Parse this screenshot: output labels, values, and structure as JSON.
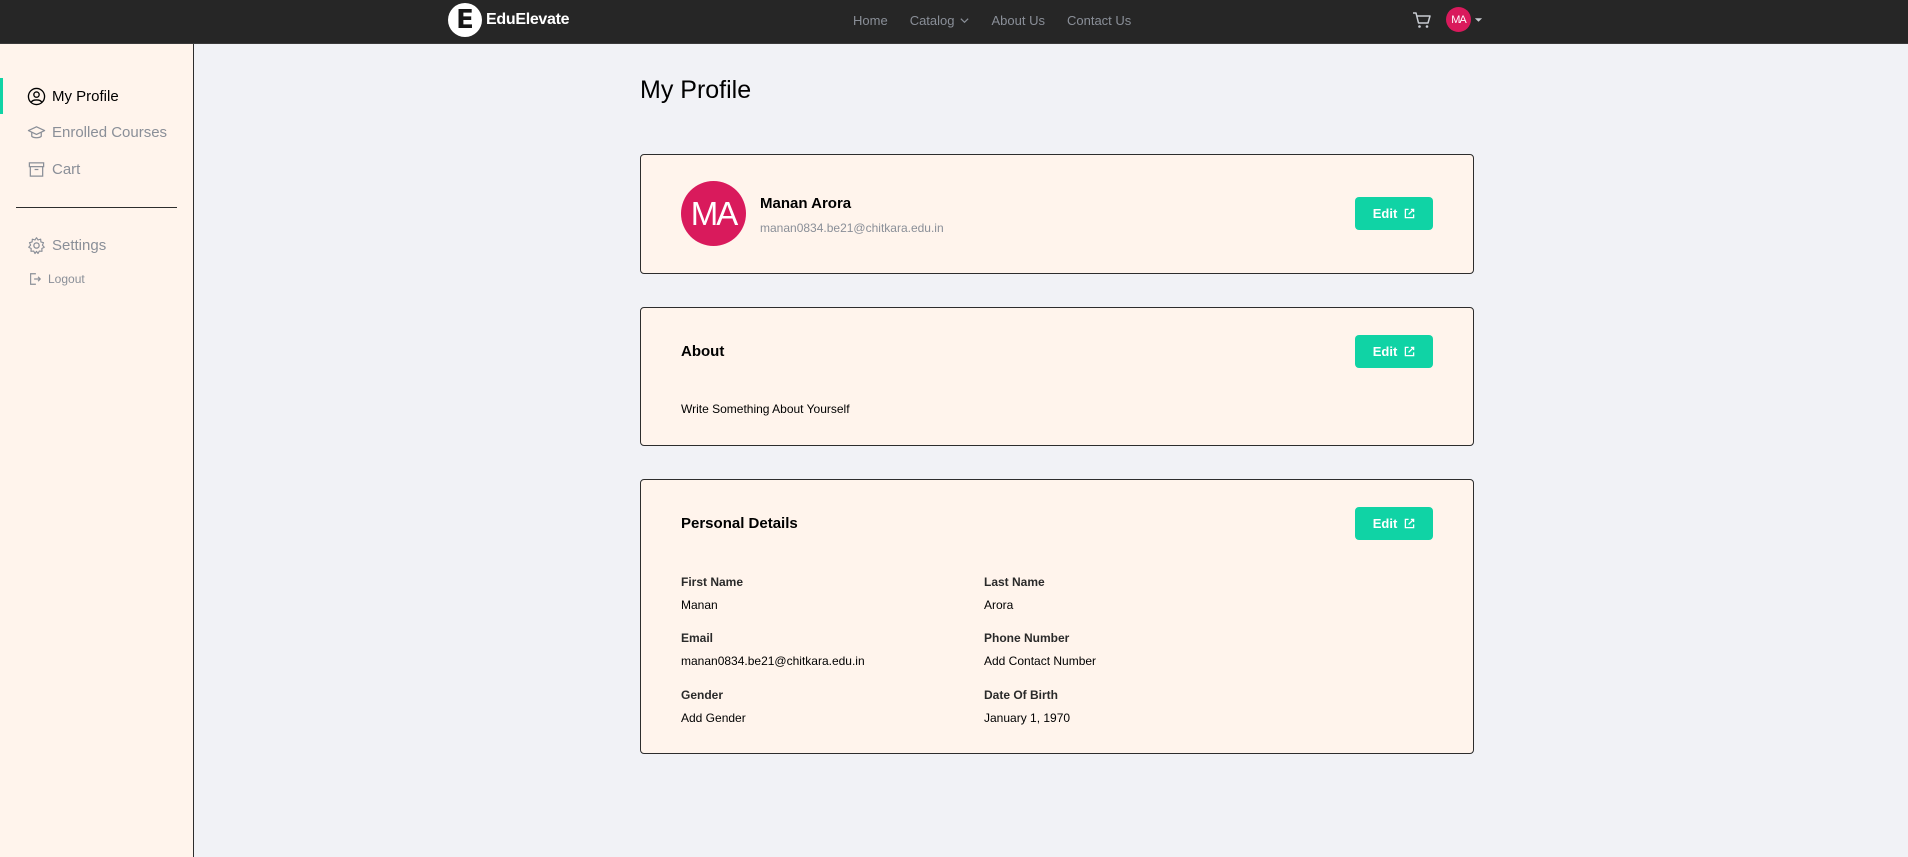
{
  "brand": {
    "logo_letter": "E",
    "name": "EduElevate"
  },
  "nav": {
    "home": "Home",
    "catalog": "Catalog",
    "about": "About Us",
    "contact": "Contact Us"
  },
  "user": {
    "initials": "MA",
    "name": "Manan Arora",
    "email": "manan0834.be21@chitkara.edu.in"
  },
  "sidebar": {
    "items": [
      {
        "label": "My Profile",
        "icon": "user-circle-icon",
        "active": true
      },
      {
        "label": "Enrolled Courses",
        "icon": "graduation-cap-icon"
      },
      {
        "label": "Cart",
        "icon": "archive-box-icon"
      }
    ],
    "settings": "Settings",
    "logout": "Logout"
  },
  "page": {
    "title": "My Profile"
  },
  "buttons": {
    "edit": "Edit"
  },
  "about": {
    "heading": "About",
    "text": "Write Something About Yourself"
  },
  "details": {
    "heading": "Personal Details",
    "first_name_label": "First Name",
    "first_name": "Manan",
    "last_name_label": "Last Name",
    "last_name": "Arora",
    "email_label": "Email",
    "email": "manan0834.be21@chitkara.edu.in",
    "phone_label": "Phone Number",
    "phone": "Add Contact Number",
    "gender_label": "Gender",
    "gender": "Add Gender",
    "dob_label": "Date Of Birth",
    "dob": "January 1, 1970"
  },
  "colors": {
    "accent": "#10d3a5",
    "avatar": "#d91a5c",
    "card_bg": "#fff4ec",
    "page_bg": "#f1f2f6",
    "topbar": "#262626"
  }
}
